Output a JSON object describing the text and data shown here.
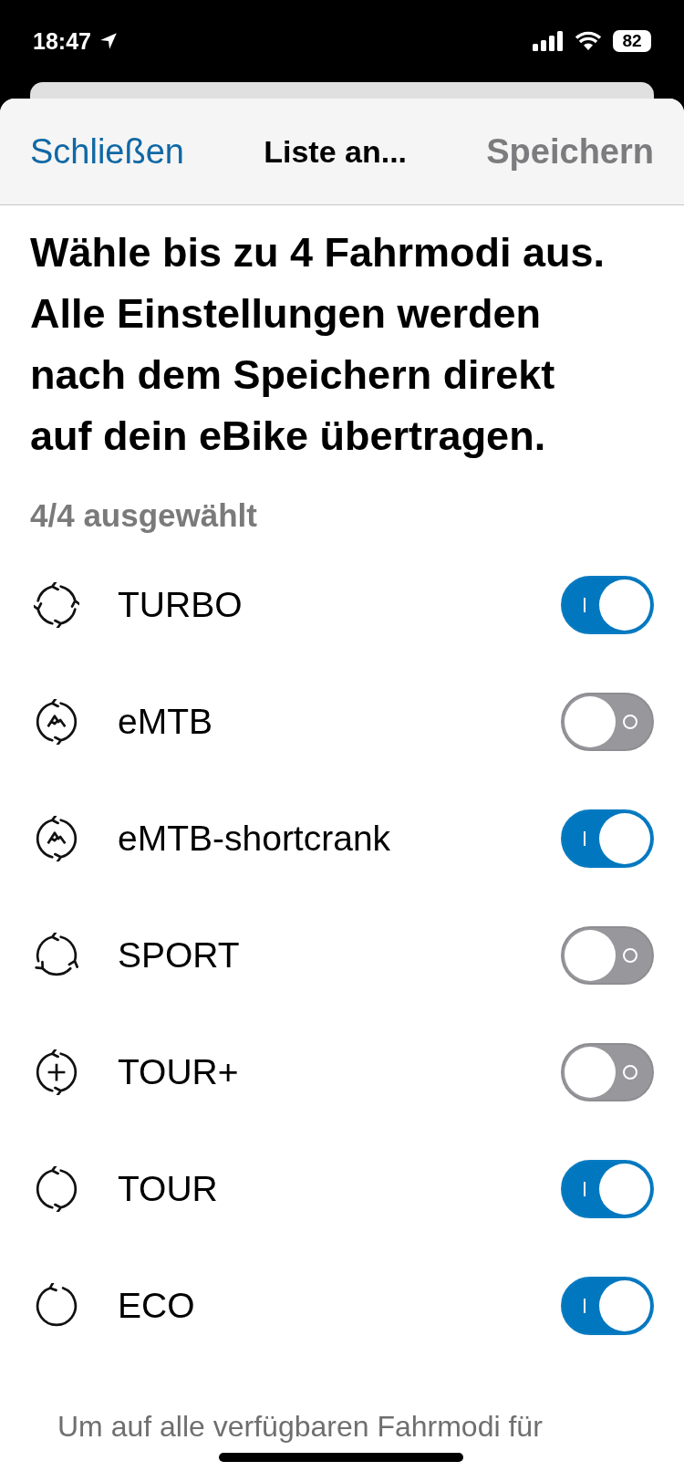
{
  "status_bar": {
    "time": "18:47",
    "battery": "82"
  },
  "nav": {
    "close": "Schließen",
    "title": "Liste an...",
    "save": "Speichern",
    "save_disabled": true
  },
  "intro": "Wähle bis zu 4 Fahrmodi aus. Alle Einstellungen werden nach dem Speichern direkt auf dein eBike übertragen.",
  "count": "4/4 ausgewählt",
  "modes": [
    {
      "name": "TURBO",
      "kind": "arrows4",
      "on": true
    },
    {
      "name": "eMTB",
      "kind": "mountain",
      "on": false
    },
    {
      "name": "eMTB-shortcrank",
      "kind": "mountain",
      "on": true
    },
    {
      "name": "SPORT",
      "kind": "arrows3",
      "on": false
    },
    {
      "name": "TOUR+",
      "kind": "plus",
      "on": false
    },
    {
      "name": "TOUR",
      "kind": "arrows2",
      "on": true
    },
    {
      "name": "ECO",
      "kind": "arrows1",
      "on": true
    }
  ],
  "footer": "Um auf alle verfügbaren Fahrmodi für"
}
